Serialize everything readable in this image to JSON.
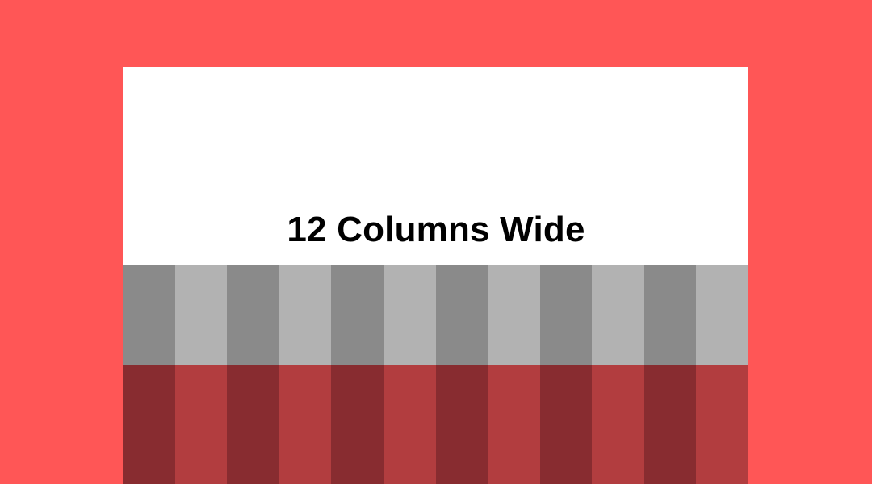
{
  "heading": "12 Columns Wide",
  "column_count": 12,
  "colors": {
    "background": "#ff5656",
    "card": "#ffffff",
    "heading_text": "#000000",
    "top_dark": "#8a8a8a",
    "top_light": "#b2b2b2",
    "bottom_dark": "#882c30",
    "bottom_light": "#b23d3f"
  }
}
